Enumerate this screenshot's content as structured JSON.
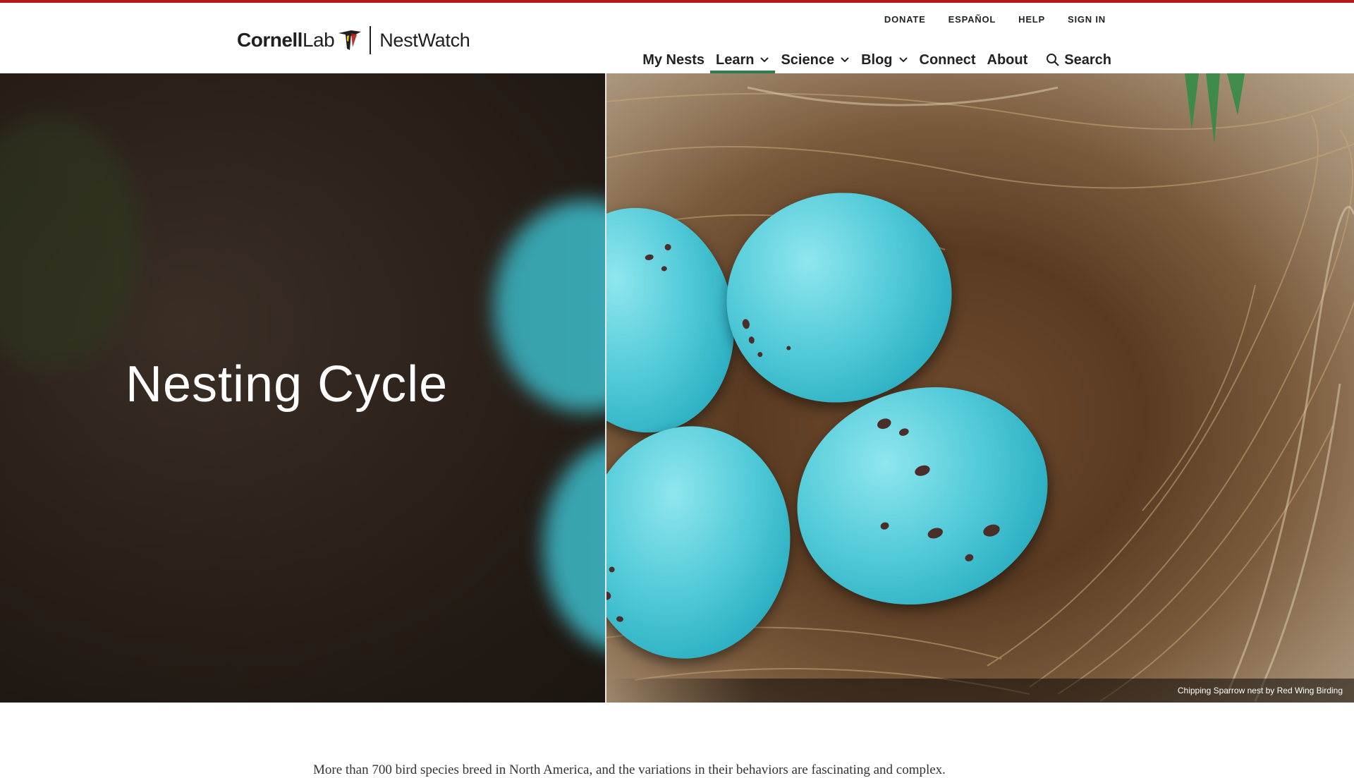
{
  "brand": {
    "cornell": "Cornell",
    "lab": "Lab",
    "nestwatch": "NestWatch"
  },
  "utility_nav": [
    "DONATE",
    "ESPAÑOL",
    "HELP",
    "SIGN IN"
  ],
  "main_nav": {
    "my_nests": "My Nests",
    "learn": "Learn",
    "science": "Science",
    "blog": "Blog",
    "connect": "Connect",
    "about": "About",
    "search": "Search",
    "active_item": "Learn"
  },
  "hero": {
    "title": "Nesting Cycle",
    "caption": "Chipping Sparrow nest by Red Wing Birding"
  },
  "intro": {
    "text": "More than 700 bird species breed in North America, and the variations in their behaviors are fascinating and complex."
  },
  "colors": {
    "accent_red": "#b31b1b",
    "active_underline": "#2e7d4f",
    "egg_blue": "#52cad8"
  }
}
